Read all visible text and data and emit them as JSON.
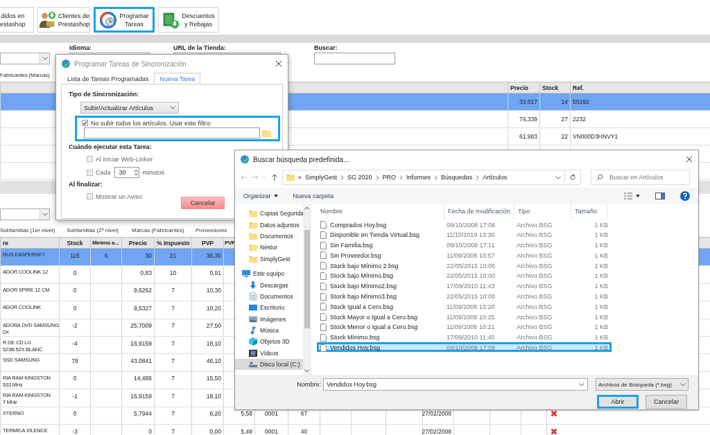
{
  "toolbar": [
    {
      "kind": "text_only",
      "label": "didos en\nestashop",
      "highlighted": false
    },
    {
      "kind": "customers",
      "label": "Clientes de\nPrestashop",
      "highlighted": false
    },
    {
      "kind": "schedule",
      "label": "Programar\nTareas",
      "highlighted": true
    },
    {
      "kind": "discounts",
      "label": "Descuentos\ny Rebajas",
      "highlighted": false
    }
  ],
  "filters": {
    "language_label": "Idioma:",
    "url_label": "URL de la Tienda:",
    "search_label": "Buscar:"
  },
  "upper_tab": "Fabricantes (Marcas)",
  "upper_table": {
    "columns": [
      "Precio",
      "Stock",
      "Ref."
    ],
    "rows": [
      {
        "cells": [
          "33,017",
          "14",
          "50192"
        ],
        "selected": true
      },
      {
        "cells": [
          "74,339",
          "27",
          "2232"
        ],
        "selected": false
      },
      {
        "cells": [
          "61,983",
          "22",
          "VN000D3HNVY1"
        ],
        "selected": false
      }
    ]
  },
  "lower_tabs": [
    "Subfamilias (1er nivel)",
    "Subfamilias (2º nivel)",
    "Marcas (Fabricantes)",
    "Proveedores"
  ],
  "lower_table": {
    "columns": [
      "re",
      "Stock",
      "Mínimo a...",
      "Precio",
      "% Impuesto",
      "PVP",
      "PVP"
    ],
    "rows": [
      {
        "cells": [
          "RUS KASPERSKY",
          "115",
          "6",
          "30",
          "21",
          "36,30"
        ],
        "selected": true
      },
      {
        "cells": [
          "ADOR COOLINK 12",
          "0",
          null,
          "0,83",
          "10",
          "0,91"
        ],
        "selected": false
      },
      {
        "cells": [
          "ADOR SPIRE 12 CM",
          "0",
          null,
          "9,6262",
          "7",
          "10,30"
        ],
        "selected": false
      },
      {
        "cells": [
          "ADOR COOLINK",
          "0",
          null,
          "9,5327",
          "7",
          "10,20"
        ],
        "selected": false
      },
      {
        "cells": [
          "ADORA DVD SAMSUNG\n0X",
          "-2",
          null,
          "25,7009",
          "7",
          "27,50"
        ],
        "selected": false
      },
      {
        "cells": [
          "R DE CD LG\n523B 52X BLANC",
          "-4",
          null,
          "16,9159",
          "7",
          "18,10"
        ],
        "selected": false
      },
      {
        "cells": [
          "SSD SAMSUNG",
          "78",
          null,
          "43,0841",
          "7",
          "46,10"
        ],
        "selected": false
      },
      {
        "cells": [
          "RIA RAM KINGSTON\n533 MHz",
          "0",
          null,
          "14,486",
          "7",
          "15,50"
        ],
        "selected": false
      },
      {
        "cells": [
          "RIA RAM KINGSTON\n7 MHz",
          "-1",
          null,
          "16,9159",
          "7",
          "18,10"
        ],
        "selected": false
      },
      {
        "cells": [
          "XTERNO",
          "0",
          null,
          "5,7944",
          "7",
          "6,20",
          "5,58",
          "0001",
          "67",
          null,
          null,
          null,
          "27/02/2008"
        ],
        "selected": false,
        "delete": true
      },
      {
        "cells": [
          "TERMICA XILENCE",
          "-3",
          null,
          "0",
          "7",
          "0,00",
          "5,49",
          "0001",
          "40",
          null,
          null,
          null,
          "27/02/2008"
        ],
        "selected": false,
        "delete": true
      }
    ]
  },
  "sync_dialog": {
    "title": "Programar Tareas de Sincronización",
    "tabs": [
      {
        "label": "Lista de Tareas Programadas",
        "selected": false
      },
      {
        "label": "Nueva Tarea",
        "selected": true
      }
    ],
    "type_label": "Tipo de Sincronización:",
    "type_value": "Subir/Actualizar Artículos",
    "filter": {
      "label": "No subir todos los artículos. Usar este filtro:",
      "checked": true,
      "highlighted": true
    },
    "when_label": "Cuándo ejecutar esta Tarea:",
    "on_start": {
      "label": "Al iniciar Web-Linker",
      "checked": false
    },
    "every": {
      "label": "Cada",
      "checked": false,
      "value": "30",
      "unit": "minutos"
    },
    "finish_label": "Al finalizar:",
    "notify": {
      "label": "Mostrar un Aviso",
      "checked": false
    },
    "cancel": "Cancelar"
  },
  "file_dialog": {
    "title": "Buscar búsqueda predefinida...",
    "overflow_mark": "«",
    "breadcrumbs": [
      "SimplyGest",
      "SG 2020",
      "PRO",
      "Informes",
      "Búsquedas",
      "Artículos"
    ],
    "search_placeholder": "Buscar en Artículos",
    "organize": "Organizar",
    "new_folder": "Nueva carpeta",
    "nav": [
      {
        "kind": "folder",
        "label": "Copias Segurida",
        "selected": false
      },
      {
        "kind": "folder",
        "label": "Datos adjuntos",
        "selected": false
      },
      {
        "kind": "folder",
        "label": "Documentos",
        "selected": false
      },
      {
        "kind": "folder",
        "label": "Néstor",
        "selected": false
      },
      {
        "kind": "folder",
        "label": "SimplyGest",
        "selected": false
      },
      {
        "kind": "computer",
        "label": "Este equipo",
        "selected": false
      },
      {
        "kind": "download",
        "label": "Descargas",
        "selected": false
      },
      {
        "kind": "documents",
        "label": "Documentos",
        "selected": false
      },
      {
        "kind": "desktop",
        "label": "Escritorio",
        "selected": false
      },
      {
        "kind": "pictures",
        "label": "Imágenes",
        "selected": false
      },
      {
        "kind": "music",
        "label": "Música",
        "selected": false
      },
      {
        "kind": "objects",
        "label": "Objetos 3D",
        "selected": false
      },
      {
        "kind": "videos",
        "label": "Vídeos",
        "selected": false
      },
      {
        "kind": "drive",
        "label": "Disco local (C:)",
        "selected": true
      }
    ],
    "columns": [
      "Nombre",
      "Fecha de modificación",
      "Tipo",
      "Tamaño"
    ],
    "files": [
      {
        "name": "Comprados Hoy.bsg",
        "modified": "09/10/2008 17:08",
        "type": "Archivo BSG",
        "size": "1 KB",
        "selected": false,
        "highlighted": false
      },
      {
        "name": "Disponible en Tienda Virtual.bsg",
        "modified": "11/10/2019 13:30",
        "type": "Archivo BSG",
        "size": "1 KB",
        "selected": false,
        "highlighted": false
      },
      {
        "name": "Sin Familia.bsg",
        "modified": "09/10/2008 17:11",
        "type": "Archivo BSG",
        "size": "1 KB",
        "selected": false,
        "highlighted": false
      },
      {
        "name": "Sin Proveedor.bsg",
        "modified": "11/09/2008 10:57",
        "type": "Archivo BSG",
        "size": "1 KB",
        "selected": false,
        "highlighted": false
      },
      {
        "name": "Stock bajo Mínimo 2.bsg",
        "modified": "22/05/2015 10:00",
        "type": "Archivo BSG",
        "size": "1 KB",
        "selected": false,
        "highlighted": false
      },
      {
        "name": "Stock bajo Mínimo.bsg",
        "modified": "22/05/2015 10:00",
        "type": "Archivo BSG",
        "size": "1 KB",
        "selected": false,
        "highlighted": false
      },
      {
        "name": "Stock bajo Mínimo2.bsg",
        "modified": "17/09/2010 11:43",
        "type": "Archivo BSG",
        "size": "1 KB",
        "selected": false,
        "highlighted": false
      },
      {
        "name": "Stock bajo Mínimo3.bsg",
        "modified": "22/05/2015 10:00",
        "type": "Archivo BSG",
        "size": "1 KB",
        "selected": false,
        "highlighted": false
      },
      {
        "name": "Stock Igual a Cero.bsg",
        "modified": "11/09/2008 10:20",
        "type": "Archivo BSG",
        "size": "1 KB",
        "selected": false,
        "highlighted": false
      },
      {
        "name": "Stock Mayor o Igual a Cero.bsg",
        "modified": "11/09/2008 10:25",
        "type": "Archivo BSG",
        "size": "1 KB",
        "selected": false,
        "highlighted": false
      },
      {
        "name": "Stock Menor o Igual a Cero.bsg",
        "modified": "11/09/2008 10:21",
        "type": "Archivo BSG",
        "size": "1 KB",
        "selected": false,
        "highlighted": false
      },
      {
        "name": "Stock Mínimo.bsg",
        "modified": "17/09/2010 11:40",
        "type": "Archivo BSG",
        "size": "1 KB",
        "selected": false,
        "highlighted": false
      },
      {
        "name": "Vendidos Hoy.bsg",
        "modified": "09/10/2008 17:09",
        "type": "Archivo BSG",
        "size": "1 KB",
        "selected": true,
        "highlighted": true
      }
    ],
    "name_label": "Nombre:",
    "name_value": "Vendidos Hoy.bsg",
    "file_type": "Archivos de Búsqueda (*.bsg)",
    "open": {
      "label": "Abrir",
      "highlighted": true
    },
    "cancel": "Cancelar"
  }
}
